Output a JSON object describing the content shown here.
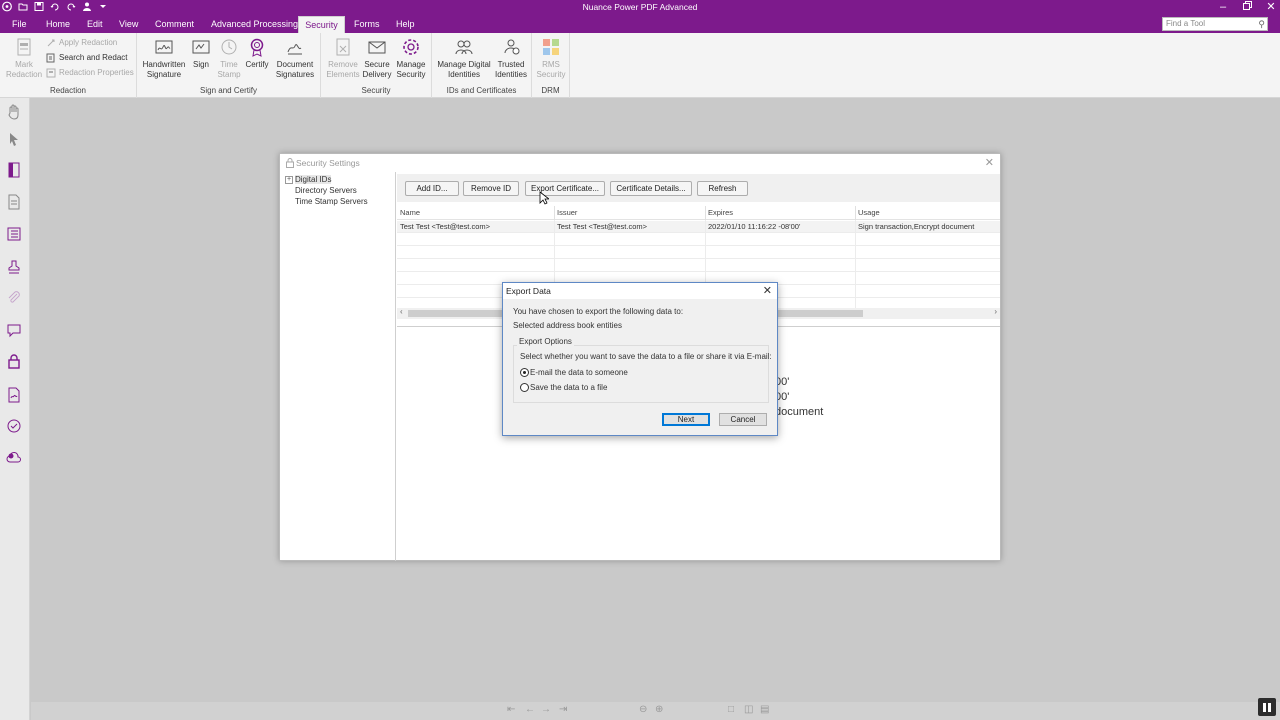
{
  "app": {
    "title": "Nuance Power PDF Advanced",
    "colors": {
      "brand": "#7d1a8c",
      "ribbon_bg": "#f4f4f4",
      "workspace_bg": "#c9c9c9",
      "focus": "#0078d7"
    }
  },
  "titlebar": {
    "qat_icons": [
      "app-menu-icon",
      "open-icon",
      "save-icon",
      "undo-icon",
      "redo-icon",
      "user-icon",
      "customize-icon"
    ],
    "controls": [
      "minimize-icon",
      "restore-icon",
      "close-icon"
    ]
  },
  "menu": {
    "tabs": [
      "File",
      "Home",
      "Edit",
      "View",
      "Comment",
      "Advanced Processing",
      "Security",
      "Forms",
      "Help"
    ],
    "active": "Security",
    "find_placeholder": "Find a Tool"
  },
  "ribbon": {
    "groups": {
      "redaction": {
        "label": "Redaction",
        "mark": "Mark Redaction",
        "mark_l1": "Mark",
        "mark_l2": "Redaction",
        "apply": "Apply Redaction",
        "search": "Search and Redact",
        "properties": "Redaction Properties"
      },
      "sign": {
        "label": "Sign and Certify",
        "handwritten_l1": "Handwritten",
        "handwritten_l2": "Signature",
        "sign": "Sign",
        "timestamp_l1": "Time",
        "timestamp_l2": "Stamp",
        "certify": "Certify",
        "docsig_l1": "Document",
        "docsig_l2": "Signatures"
      },
      "security": {
        "label": "Security",
        "remove_l1": "Remove",
        "remove_l2": "Elements",
        "secure_l1": "Secure",
        "secure_l2": "Delivery",
        "manage_l1": "Manage",
        "manage_l2": "Security"
      },
      "ids": {
        "label": "IDs and Certificates",
        "manage_l1": "Manage Digital",
        "manage_l2": "Identities",
        "trusted_l1": "Trusted",
        "trusted_l2": "Identities"
      },
      "drm": {
        "label": "DRM",
        "rms_l1": "RMS",
        "rms_l2": "Security"
      }
    }
  },
  "security_settings": {
    "title": "Security Settings",
    "tree": [
      "Digital IDs",
      "Directory Servers",
      "Time Stamp Servers"
    ],
    "toolbar": {
      "add": "Add ID...",
      "remove": "Remove ID",
      "export": "Export Certificate...",
      "details": "Certificate Details...",
      "refresh": "Refresh"
    },
    "columns": [
      "Name",
      "Issuer",
      "Expires",
      "Usage"
    ],
    "rows": [
      [
        "Test Test <Test@test.com>",
        "Test Test <Test@test.com>",
        "2022/01/10 11:16:22 -08'00'",
        "Sign transaction,Encrypt document"
      ]
    ],
    "detail_fragments": [
      "00'",
      "00'",
      "document"
    ]
  },
  "export_dialog": {
    "title": "Export Data",
    "intro": "You have chosen to export the following data to:",
    "selected": "Selected address book entities",
    "options_legend": "Export Options",
    "options_prompt": "Select whether you want to save the data to a file or share it via E-mail:",
    "option_email": "E-mail the data to someone",
    "option_file": "Save the data to a file",
    "selected_option": "email",
    "next": "Next",
    "cancel": "Cancel"
  }
}
